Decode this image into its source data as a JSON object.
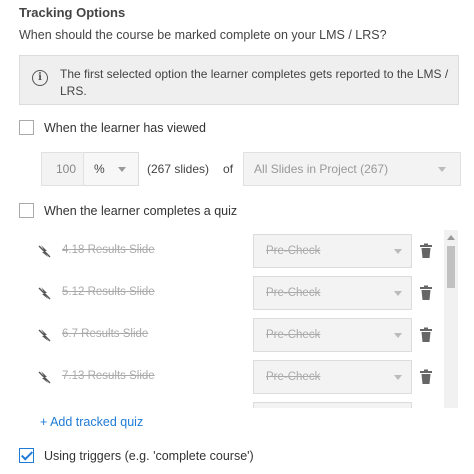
{
  "header": {
    "title": "Tracking Options",
    "subtitle": "When should the course be marked complete on your LMS / LRS?"
  },
  "info": {
    "icon": "info-circle-icon",
    "text": "The first selected option the learner completes gets reported to the LMS / LRS."
  },
  "viewed": {
    "label": "When the learner has viewed",
    "checked": false,
    "amount_value": "100",
    "unit_selected": "%",
    "slides_count": "(267 slides)",
    "of_label": "of",
    "scope_selected": "All Slides in Project (267)"
  },
  "quiz": {
    "label": "When the learner completes a quiz",
    "checked": false,
    "items": [
      {
        "name": "4.18 Results Slide",
        "selection": "Pre-Check"
      },
      {
        "name": "5.12 Results Slide",
        "selection": "Pre-Check"
      },
      {
        "name": "6.7 Results Slide",
        "selection": "Pre-Check"
      },
      {
        "name": "7.13 Results Slide",
        "selection": "Pre-Check"
      }
    ],
    "add_label": "+ Add tracked quiz"
  },
  "triggers": {
    "label": "Using triggers (e.g. 'complete course')",
    "checked": true
  },
  "colors": {
    "accent": "#1e7bd6",
    "disabled_text": "#aaaaaa",
    "info_bg": "#efefef"
  }
}
